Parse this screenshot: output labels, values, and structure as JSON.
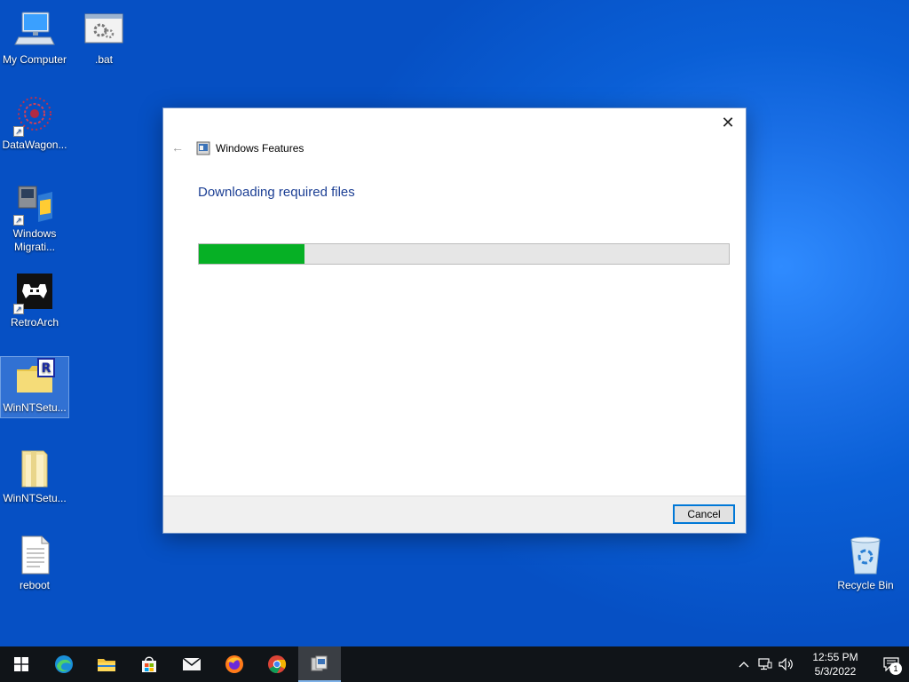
{
  "desktop": {
    "icons": [
      {
        "label": "My Computer"
      },
      {
        "label": ".bat"
      },
      {
        "label": "DataWagon..."
      },
      {
        "label": "Windows Migrati..."
      },
      {
        "label": "RetroArch"
      },
      {
        "label": "WinNTSetu..."
      },
      {
        "label": "WinNTSetu..."
      },
      {
        "label": "reboot"
      },
      {
        "label": "Recycle Bin"
      }
    ]
  },
  "dialog": {
    "title": "Windows Features",
    "heading": "Downloading required files",
    "progress_fraction": 0.2,
    "cancel_label": "Cancel",
    "close_glyph": "✕",
    "back_glyph": "←"
  },
  "taskbar": {
    "apps": [
      {
        "icon": "windows-start-icon"
      },
      {
        "icon": "edge-icon"
      },
      {
        "icon": "file-explorer-icon"
      },
      {
        "icon": "microsoft-store-icon"
      },
      {
        "icon": "mail-icon"
      },
      {
        "icon": "firefox-icon"
      },
      {
        "icon": "chrome-icon"
      },
      {
        "icon": "windows-features-icon"
      }
    ],
    "time": "12:55 PM",
    "date": "5/3/2022",
    "notification_count": "1"
  },
  "colors": {
    "progress_fill": "#06b025",
    "heading": "#1c3f94",
    "taskbar": "#101418",
    "accent": "#0078d7"
  }
}
